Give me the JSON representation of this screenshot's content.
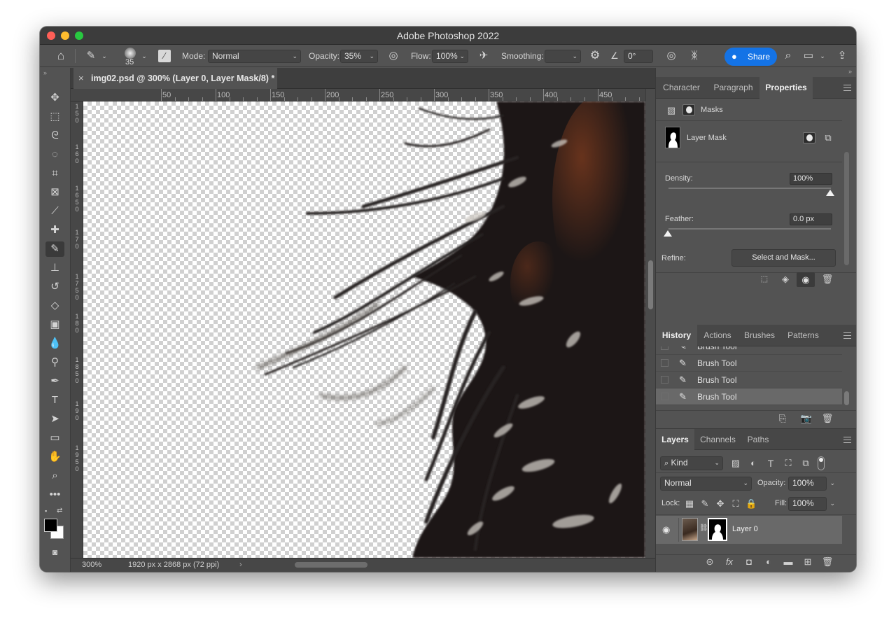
{
  "app": {
    "title": "Adobe Photoshop 2022"
  },
  "options_bar": {
    "brush_size": "35",
    "mode_label": "Mode:",
    "mode_value": "Normal",
    "opacity_label": "Opacity:",
    "opacity_value": "35%",
    "flow_label": "Flow:",
    "flow_value": "100%",
    "smoothing_label": "Smoothing:",
    "smoothing_value": "",
    "angle_value": "0°",
    "share_label": "Share"
  },
  "document": {
    "tab_title": "img02.psd @ 300% (Layer 0, Layer Mask/8) *",
    "zoom": "300%",
    "doc_info": "1920 px x 2868 px (72 ppi)"
  },
  "rulers": {
    "h_labels": [
      "50",
      "100",
      "150",
      "200",
      "250",
      "300",
      "350",
      "400",
      "450",
      "500"
    ],
    "v_labels": [
      "1\n5\n0",
      "1\n6\n0",
      "1\n6\n5\n0",
      "1\n7\n0",
      "1\n7\n5\n0",
      "1\n8\n0",
      "1\n8\n5\n0",
      "1\n9\n0",
      "1\n9\n5\n0"
    ]
  },
  "properties_panel": {
    "tabs": [
      "Character",
      "Paragraph",
      "Properties"
    ],
    "active_tab": "Properties",
    "masks_label": "Masks",
    "layer_mask_label": "Layer Mask",
    "density_label": "Density:",
    "density_value": "100%",
    "density_level": 1.0,
    "feather_label": "Feather:",
    "feather_value": "0.0 px",
    "feather_level": 0.0,
    "refine_label": "Refine:",
    "select_mask_button": "Select and Mask..."
  },
  "history_panel": {
    "tabs": [
      "History",
      "Actions",
      "Brushes",
      "Patterns"
    ],
    "active_tab": "History",
    "items": [
      "Brush Tool",
      "Brush Tool",
      "Brush Tool",
      "Brush Tool"
    ]
  },
  "layers_panel": {
    "tabs": [
      "Layers",
      "Channels",
      "Paths"
    ],
    "active_tab": "Layers",
    "filter_value": "Kind",
    "blend_mode": "Normal",
    "opacity_label": "Opacity:",
    "opacity_value": "100%",
    "lock_label": "Lock:",
    "fill_label": "Fill:",
    "fill_value": "100%",
    "layers": [
      {
        "name": "Layer 0"
      }
    ]
  },
  "colors": {
    "accent_share": "#1473e6",
    "panel_bg": "#535353",
    "dark_bg": "#3a3a3a"
  }
}
